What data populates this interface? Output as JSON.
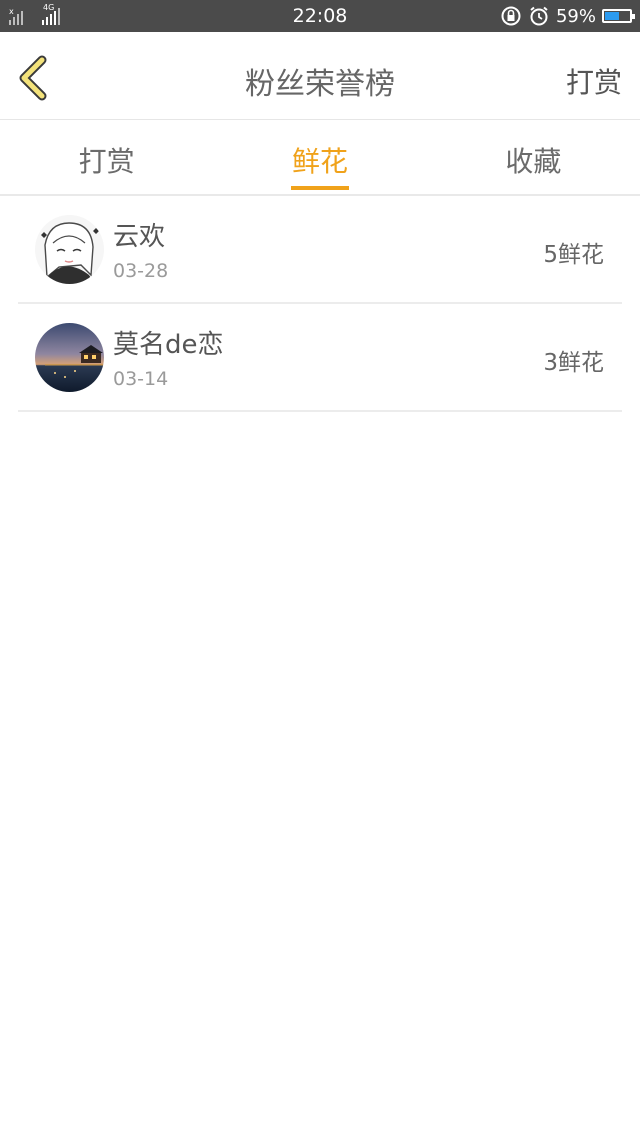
{
  "status_bar": {
    "time": "22:08",
    "battery_percent": "59%",
    "battery_level": 0.59,
    "network_label": "4G",
    "icons": [
      "signal-icon",
      "lock-rotation-icon",
      "alarm-icon",
      "battery-icon"
    ]
  },
  "header": {
    "title": "粉丝荣誉榜",
    "action_label": "打赏",
    "back_icon": "chevron-left-icon"
  },
  "tabs": [
    {
      "label": "打赏",
      "active": false
    },
    {
      "label": "鲜花",
      "active": true
    },
    {
      "label": "收藏",
      "active": false
    }
  ],
  "list": [
    {
      "name": "云欢",
      "date": "03-28",
      "value": "5鲜花",
      "avatar": "anime-girl-avatar"
    },
    {
      "name": "莫名de恋",
      "date": "03-14",
      "value": "3鲜花",
      "avatar": "sunset-house-avatar"
    }
  ],
  "colors": {
    "accent": "#f0a21a",
    "status_bar_bg": "#4b4b4b",
    "battery_fill": "#2c9bf0"
  }
}
